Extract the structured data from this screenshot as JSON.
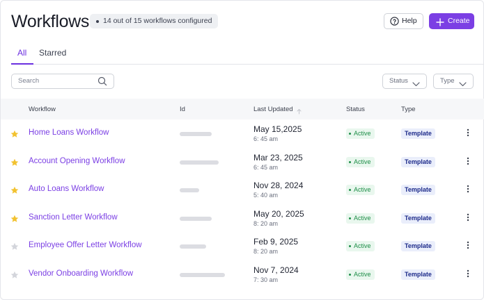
{
  "header": {
    "title": "Workflows",
    "badge": "14 out of 15 workflows configured",
    "help_label": "Help",
    "create_label": "Create"
  },
  "tabs": [
    {
      "label": "All",
      "active": true
    },
    {
      "label": "Starred",
      "active": false
    }
  ],
  "filters": {
    "search_placeholder": "Search",
    "status_label": "Status",
    "type_label": "Type"
  },
  "table": {
    "columns": {
      "workflow": "Workflow",
      "id": "Id",
      "last_updated": "Last Updated",
      "status": "Status",
      "type": "Type"
    },
    "rows": [
      {
        "starred": true,
        "name": "Home Loans Workflow",
        "date": "May 15,2025",
        "time": "6: 45 am",
        "status": "Active",
        "type": "Template"
      },
      {
        "starred": true,
        "name": "Account Opening Workflow",
        "date": "Mar 23, 2025",
        "time": "6: 45 am",
        "status": "Active",
        "type": "Template"
      },
      {
        "starred": true,
        "name": "Auto Loans Workflow",
        "date": "Nov 28, 2024",
        "time": "5: 40 am",
        "status": "Active",
        "type": "Template"
      },
      {
        "starred": true,
        "name": "Sanction Letter Workflow",
        "date": "May 20, 2025",
        "time": "8: 20 am",
        "status": "Active",
        "type": "Template"
      },
      {
        "starred": false,
        "name": "Employee Offer Letter Workflow",
        "date": "Feb 9, 2025",
        "time": "8: 20 am",
        "status": "Active",
        "type": "Template"
      },
      {
        "starred": false,
        "name": "Vendor Onboarding Workflow",
        "date": "Nov 7, 2024",
        "time": "7: 30 am",
        "status": "Active",
        "type": "Template"
      }
    ]
  },
  "colors": {
    "accent": "#7b3fe4",
    "star_active": "#f2c230",
    "star_inactive": "#d3d5db",
    "status_active": "#1e8e48"
  },
  "icons": {
    "help": "help-circle-icon",
    "create": "plus-icon",
    "search": "search-icon",
    "filter": "chevron-down-icon",
    "sort": "arrow-up-icon",
    "row_menu": "more-vertical-icon",
    "favorite": "star-icon"
  }
}
